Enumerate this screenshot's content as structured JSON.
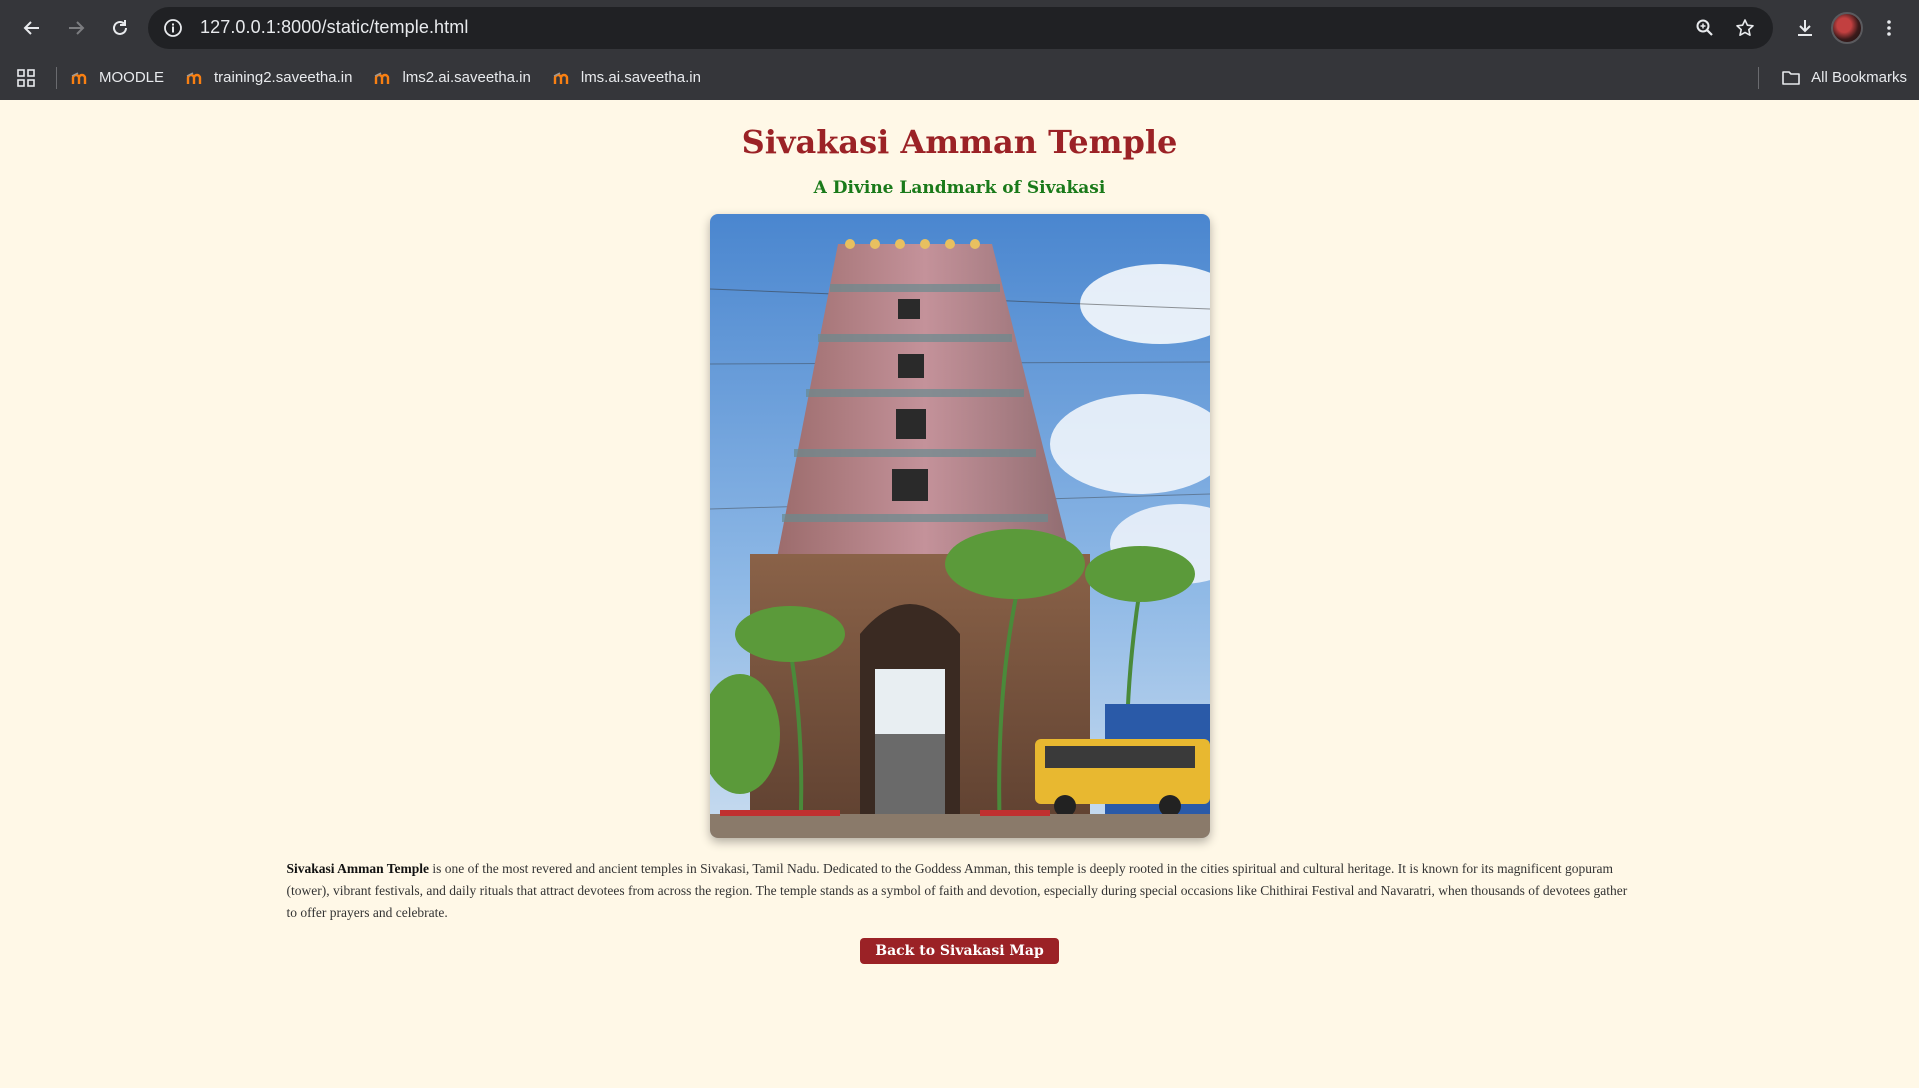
{
  "browser": {
    "url": "127.0.0.1:8000/static/temple.html",
    "bookmarks": [
      {
        "label": "MOODLE"
      },
      {
        "label": "training2.saveetha.in"
      },
      {
        "label": "lms2.ai.saveetha.in"
      },
      {
        "label": "lms.ai.saveetha.in"
      }
    ],
    "all_bookmarks_label": "All Bookmarks"
  },
  "page": {
    "title": "Sivakasi Amman Temple",
    "subtitle": "A Divine Landmark of Sivakasi",
    "description_bold": "Sivakasi Amman Temple",
    "description_rest": " is one of the most revered and ancient temples in Sivakasi, Tamil Nadu. Dedicated to the Goddess Amman, this temple is deeply rooted in the cities spiritual and cultural heritage. It is known for its magnificent gopuram (tower), vibrant festivals, and daily rituals that attract devotees from across the region. The temple stands as a symbol of faith and devotion, especially during special occasions like Chithirai Festival and Navaratri, when thousands of devotees gather to offer prayers and celebrate.",
    "back_button": "Back to Sivakasi Map"
  },
  "colors": {
    "page_bg": "#fff8e7",
    "title": "#9b2226",
    "subtitle": "#1a7a1a",
    "button_bg": "#9b2226",
    "chrome_bg": "#35363a"
  },
  "icons": [
    "back-arrow-icon",
    "forward-arrow-icon",
    "reload-icon",
    "info-icon",
    "zoom-icon",
    "star-icon",
    "download-icon",
    "menu-dots-icon",
    "apps-grid-icon",
    "moodle-favicon-icon",
    "folder-icon"
  ]
}
